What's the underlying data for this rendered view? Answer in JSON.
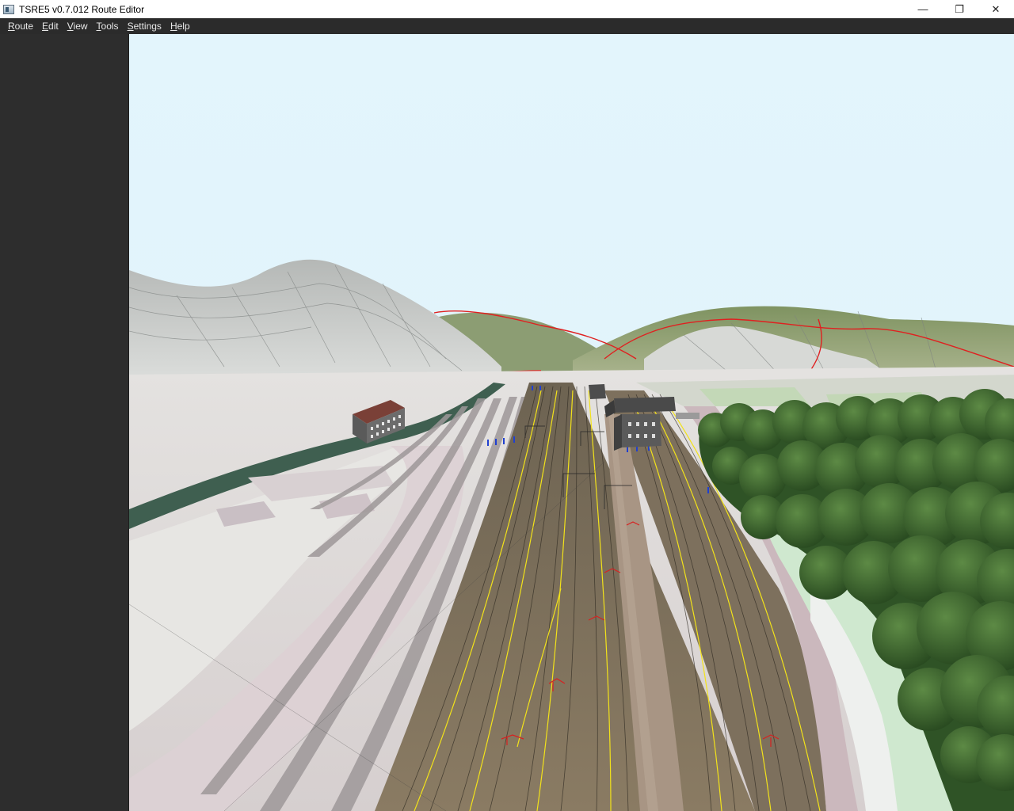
{
  "window": {
    "title": "TSRE5 v0.7.012 Route Editor",
    "controls": {
      "minimize": "—",
      "restore": "❐",
      "close": "✕"
    }
  },
  "menu": [
    {
      "label": "Route",
      "mnemonic": "R",
      "rest": "oute"
    },
    {
      "label": "Edit",
      "mnemonic": "E",
      "rest": "dit"
    },
    {
      "label": "View",
      "mnemonic": "V",
      "rest": "iew"
    },
    {
      "label": "Tools",
      "mnemonic": "T",
      "rest": "ools"
    },
    {
      "label": "Settings",
      "mnemonic": "S",
      "rest": "ettings"
    },
    {
      "label": "Help",
      "mnemonic": "H",
      "rest": "elp"
    }
  ],
  "viewport": {
    "scene": "3d-route-view",
    "colors": {
      "sky": "#e3f4fb",
      "hill_grey": "#c9cccb",
      "hill_green": "#8fa170",
      "ground": "#d9d4d2",
      "ballast": "#8a7a66",
      "platform": "#a39283",
      "rail_highlight": "#f2e21a",
      "river": "#3d5e4e",
      "trees": "#3f6b34",
      "boundary_red": "#e02020"
    }
  }
}
